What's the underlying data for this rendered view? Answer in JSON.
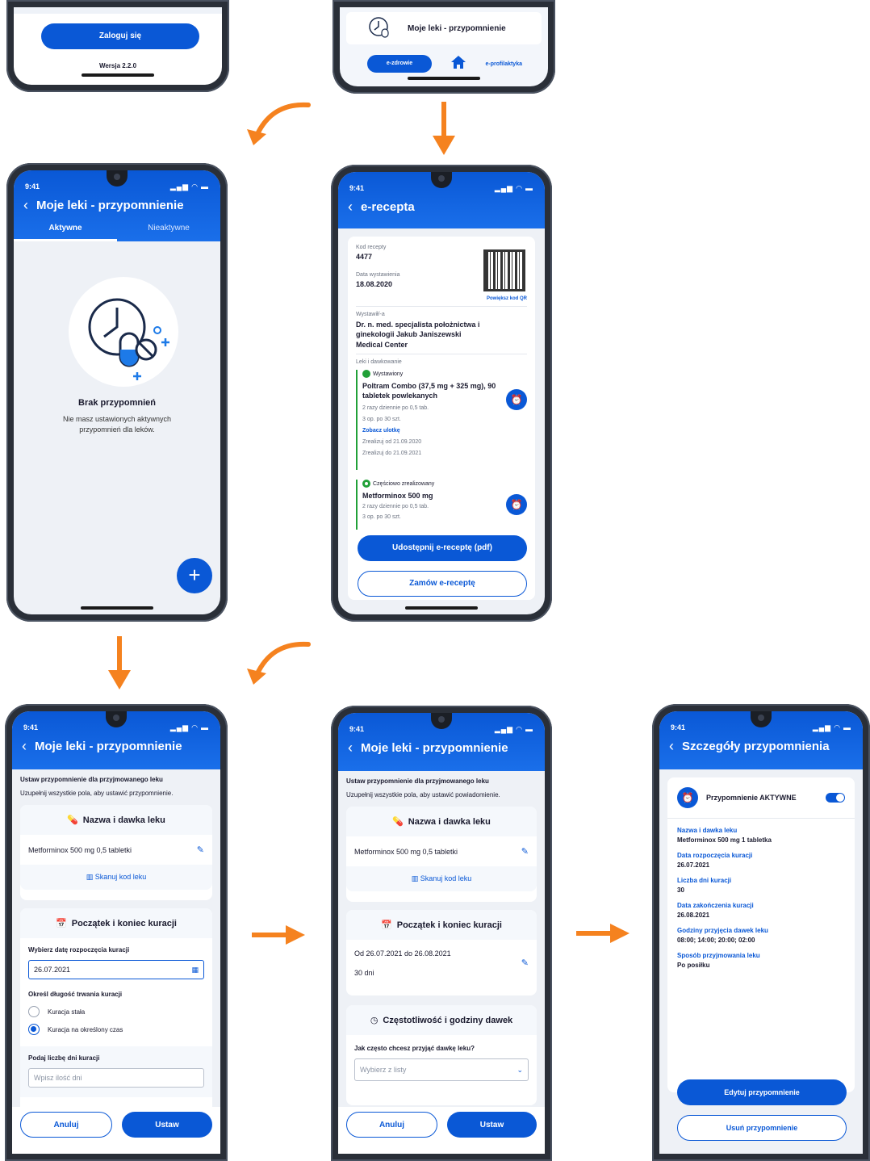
{
  "colors": {
    "primary": "#0a58d6",
    "accent": "#f5821f",
    "success": "#21a038",
    "bg": "#eef1f6"
  },
  "status_time": "9:41",
  "login_screen": {
    "login_button": "Zaloguj się",
    "version": "Wersja 2.2.0"
  },
  "home_screen": {
    "menu_item": "Moje leki - przypomnienie",
    "nav_left": "e-zdrowie",
    "nav_right": "e-profilaktyka"
  },
  "reminders_screen": {
    "title": "Moje leki - przypomnienie",
    "tab_active": "Aktywne",
    "tab_inactive": "Nieaktywne",
    "empty_title": "Brak przypomnień",
    "empty_text": "Nie masz ustawionych aktywnych przypomnień dla leków."
  },
  "erecepta_screen": {
    "title": "e-recepta",
    "code_label": "Kod recepty",
    "code_value": "4477",
    "date_label": "Data wystawienia",
    "date_value": "18.08.2020",
    "qr_link": "Powiększ kod QR",
    "issuer_label": "Wystawił/-a",
    "issuer_name": "Dr. n. med. specjalista położnictwa i ginekologii Jakub Janiszewski",
    "issuer_place": "Medical Center",
    "meds_label": "Leki i dawkowanie",
    "med1": {
      "status": "Wystawiony",
      "name": "Poltram Combo (37,5 mg + 325 mg), 90 tabletek powlekanych",
      "dose": "2 razy dziennie po 0,5 tab.",
      "packs": "3 op. po 30 szt.",
      "leaflet": "Zobacz ulotkę",
      "from": "Zrealizuj od 21.09.2020",
      "to": "Zrealizuj do 21.09.2021"
    },
    "med2": {
      "status": "Częściowo zrealizowany",
      "name": "Metforminox 500 mg",
      "dose": "2 razy dziennie po 0,5 tab.",
      "packs": "3 op. po 30 szt."
    },
    "share_button": "Udostępnij e-receptę (pdf)",
    "order_button": "Zamów e-receptę"
  },
  "setup_screen_1": {
    "title": "Moje leki - przypomnienie",
    "heading": "Ustaw przypomnienie dla przyjmowanego leku",
    "subheading": "Uzupełnij wszystkie pola, aby ustawić przypomnienie.",
    "section_name": "Nazwa i dawka leku",
    "med_value": "Metforminox 500 mg 0,5 tabletki",
    "scan": "Skanuj kod leku",
    "section_dates": "Początek i koniec kuracji",
    "start_label": "Wybierz datę rozpoczęcia kuracji",
    "start_value": "26.07.2021",
    "length_label": "Określ długość trwania kuracji",
    "radio1": "Kuracja stała",
    "radio2": "Kuracja na określony czas",
    "days_label": "Podaj liczbę dni kuracji",
    "days_placeholder": "Wpisz ilość dni",
    "cancel": "Anuluj",
    "confirm": "Ustaw"
  },
  "setup_screen_2": {
    "title": "Moje leki - przypomnienie",
    "heading": "Ustaw przypomnienie dla przyjmowanego leku",
    "subheading": "Uzupełnij wszystkie pola, aby ustawić powiadomienie.",
    "section_name": "Nazwa i dawka leku",
    "med_value": "Metforminox 500 mg 0,5 tabletki",
    "scan": "Skanuj kod leku",
    "section_dates": "Początek i koniec kuracji",
    "range": "Od 26.07.2021 do 26.08.2021",
    "days": "30 dni",
    "section_freq": "Częstotliwość i godziny dawek",
    "freq_label": "Jak często chcesz przyjąć dawkę leku?",
    "freq_placeholder": "Wybierz z listy",
    "cancel": "Anuluj",
    "confirm": "Ustaw"
  },
  "details_screen": {
    "title": "Szczegóły przypomnienia",
    "status": "Przypomnienie AKTYWNE",
    "fields": [
      {
        "label": "Nazwa i dawka leku",
        "value": "Metforminox 500 mg 1 tabletka"
      },
      {
        "label": "Data rozpoczęcia kuracji",
        "value": "26.07.2021"
      },
      {
        "label": "Liczba dni kuracji",
        "value": "30"
      },
      {
        "label": "Data zakończenia kuracji",
        "value": "26.08.2021"
      },
      {
        "label": "Godziny przyjęcia dawek leku",
        "value": "08:00; 14:00; 20:00; 02:00"
      },
      {
        "label": "Sposób przyjmowania leku",
        "value": "Po posiłku"
      }
    ],
    "edit_button": "Edytuj przypomnienie",
    "delete_button": "Usuń przypomnienie"
  }
}
